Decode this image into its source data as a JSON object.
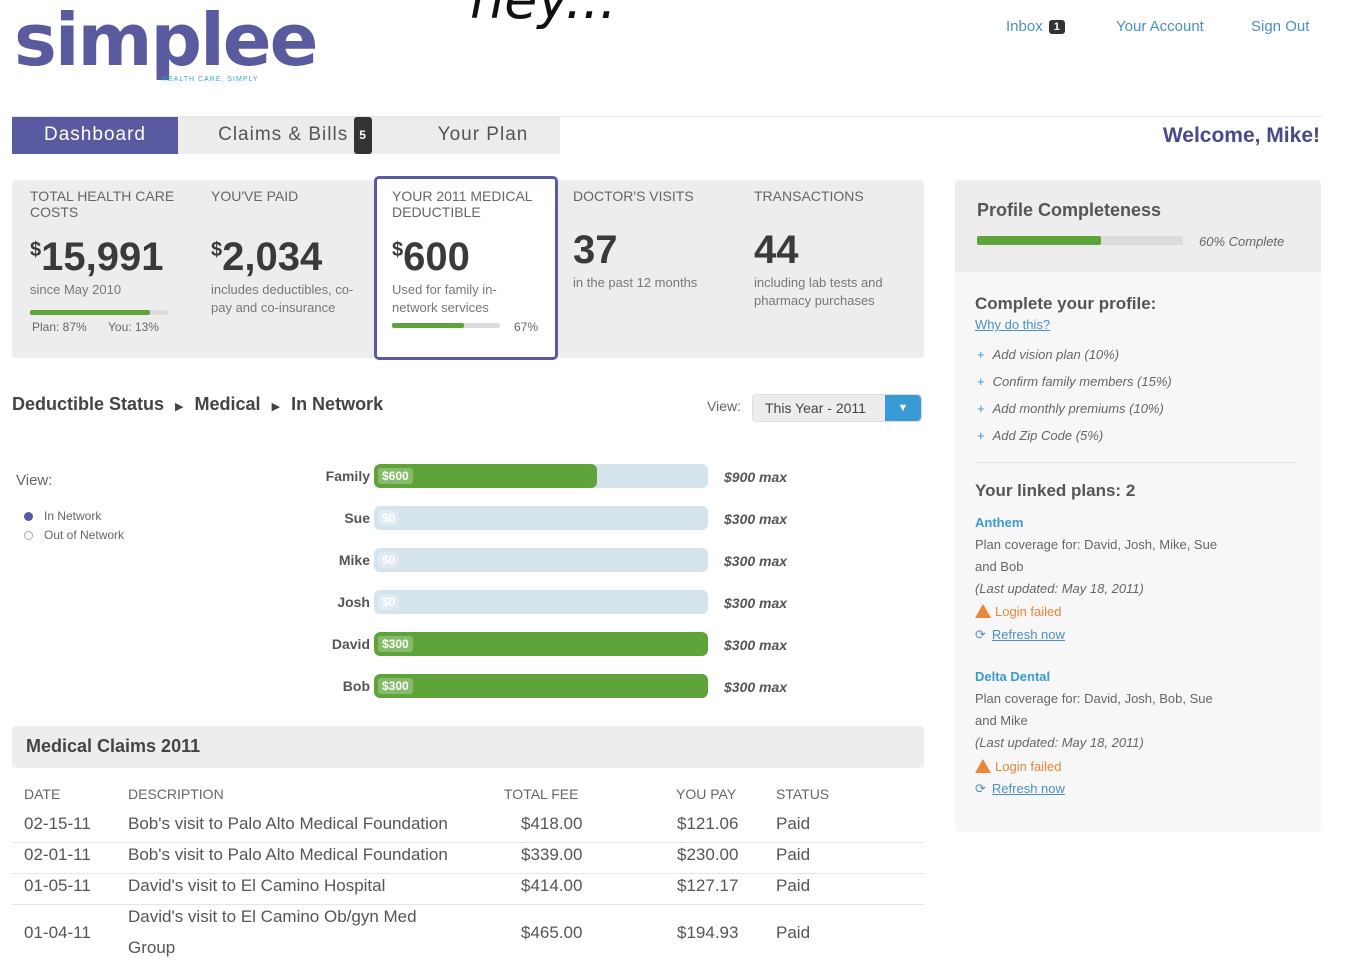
{
  "header": {
    "logo_text": "simplee",
    "logo_tagline": "HEALTH CARE, SIMPLY",
    "overlay_text": "ney...",
    "links": [
      {
        "label": "Inbox",
        "badge": "1"
      },
      {
        "label": "Your Account"
      },
      {
        "label": "Sign Out"
      }
    ]
  },
  "nav": {
    "tabs": [
      {
        "label": "Dashboard",
        "active": true
      },
      {
        "label": "Claims & Bills",
        "badge": "5"
      },
      {
        "label": "Your Plan"
      }
    ],
    "welcome": "Welcome, Mike!"
  },
  "stats": [
    {
      "label": "TOTAL HEALTH CARE COSTS",
      "currency": "$",
      "value": "15,991",
      "desc": "since May 2010",
      "split_plan": "Plan: 87%",
      "split_you": "You: 13%",
      "progress_fraction": 0.87
    },
    {
      "label": "YOU'VE PAID",
      "currency": "$",
      "value": "2,034",
      "desc": "includes deductibles, co-pay and co-insurance"
    },
    {
      "label": "YOUR 2011 MEDICAL DEDUCTIBLE",
      "currency": "$",
      "value": "600",
      "desc": "Used for family in-network services",
      "percent": "67%",
      "progress_fraction": 0.67
    },
    {
      "label": "DOCTOR'S VISITS",
      "value": "37",
      "desc": "in the past 12 months"
    },
    {
      "label": "TRANSACTIONS",
      "value": "44",
      "desc": "including lab tests and pharmacy purchases"
    }
  ],
  "deductible": {
    "breadcrumb": [
      "Deductible Status",
      "Medical",
      "In Network"
    ],
    "view_label": "View:",
    "view_select": "This Year - 2011",
    "side_view_label": "View:",
    "network_options": [
      {
        "label": "In Network",
        "selected": true
      },
      {
        "label": "Out of Network",
        "selected": false
      }
    ],
    "bars": [
      {
        "name": "Family",
        "tag": "$600",
        "fraction": 0.667,
        "max": "$900 max"
      },
      {
        "name": "Sue",
        "tag": "$0",
        "fraction": 0,
        "max": "$300 max"
      },
      {
        "name": "Mike",
        "tag": "$0",
        "fraction": 0,
        "max": "$300 max"
      },
      {
        "name": "Josh",
        "tag": "$0",
        "fraction": 0,
        "max": "$300 max"
      },
      {
        "name": "David",
        "tag": "$300",
        "fraction": 1,
        "max": "$300 max"
      },
      {
        "name": "Bob",
        "tag": "$300",
        "fraction": 1,
        "max": "$300 max"
      }
    ]
  },
  "claims": {
    "title": "Medical Claims 2011",
    "columns": [
      "DATE",
      "DESCRIPTION",
      "TOTAL FEE",
      "YOU PAY",
      "STATUS"
    ],
    "rows": [
      {
        "date": "02-15-11",
        "desc": "Bob's visit to Palo Alto Medical Foundation",
        "fee": "$418.00",
        "pay": "$121.06",
        "status": "Paid"
      },
      {
        "date": "02-01-11",
        "desc": "Bob's visit to Palo Alto Medical Foundation",
        "fee": "$339.00",
        "pay": "$230.00",
        "status": "Paid"
      },
      {
        "date": "01-05-11",
        "desc": "David's visit to El Camino Hospital",
        "fee": "$414.00",
        "pay": "$127.17",
        "status": "Paid"
      },
      {
        "date": "01-04-11",
        "desc_line1": "David's visit to El Camino Ob/gyn Med",
        "desc_line2": "Group",
        "fee": "$465.00",
        "pay": "$194.93",
        "status": "Paid"
      }
    ]
  },
  "profile": {
    "title": "Profile Completeness",
    "complete_text": "60% Complete",
    "complete_fraction": 0.6,
    "complete_heading": "Complete your profile:",
    "why_link": "Why do this?",
    "items": [
      "Add vision plan (10%)",
      "Confirm family members (15%)",
      "Add monthly premiums (10%)",
      "Add Zip Code (5%)"
    ],
    "linked_heading": "Your linked plans: 2",
    "plans": [
      {
        "name": "Anthem",
        "coverage_1": "Plan coverage for: David, Josh, Mike, Sue",
        "coverage_2": "and Bob",
        "updated": "(Last updated: May 18, 2011)",
        "error": "Login failed",
        "refresh": "Refresh now"
      },
      {
        "name": "Delta Dental",
        "coverage_1": "Plan coverage for: David, Josh, Bob, Sue",
        "coverage_2": "and Mike",
        "updated": "(Last updated: May 18, 2011)",
        "error": "Login failed",
        "refresh": "Refresh now"
      }
    ]
  },
  "colors": {
    "brand": "#5a5aa0",
    "accent_green": "#5ea43a",
    "link_blue": "#4a90c0",
    "warning": "#e8863a"
  }
}
